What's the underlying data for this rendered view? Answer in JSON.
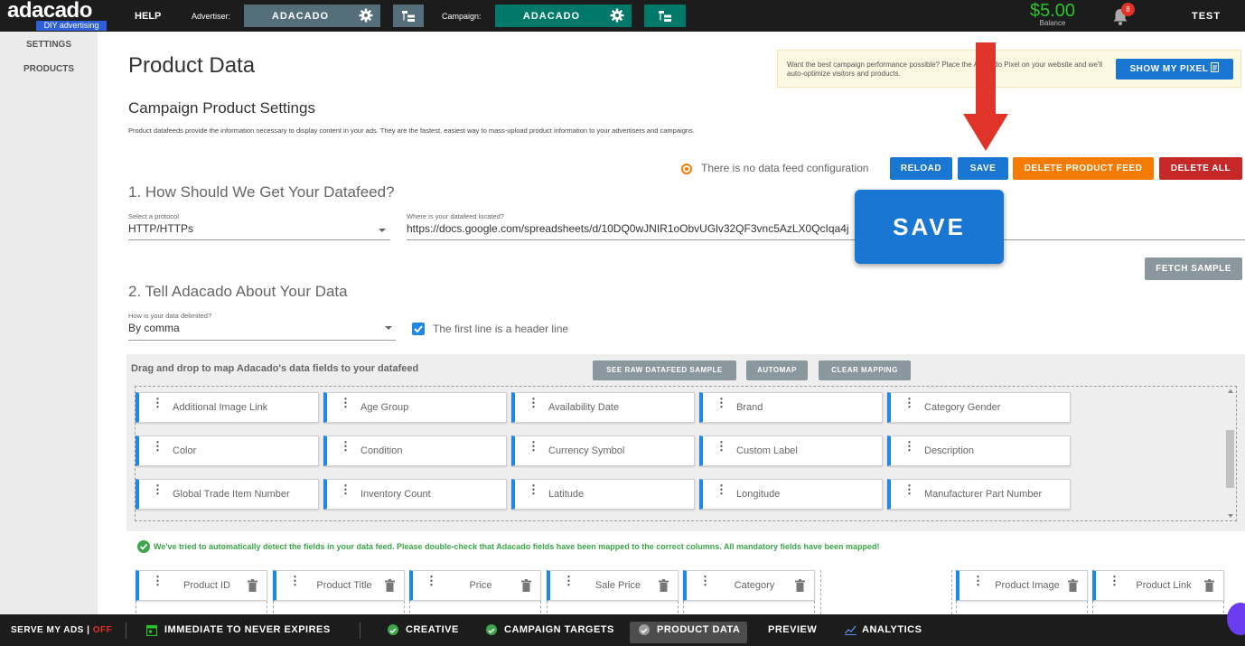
{
  "topbar": {
    "logo_text_main": "adacado",
    "logo_tagline": "DIY advertising",
    "help_label": "HELP",
    "advertiser_label": "Advertiser:",
    "advertiser_value": "ADACADO",
    "campaign_label": "Campaign:",
    "campaign_value": "ADACADO",
    "balance_amount": "$5.00",
    "balance_label": "Balance",
    "notification_count": "8",
    "user_label": "TEST",
    "colors": {
      "bar": "#1c1c1c",
      "advertiser": "#546e7a",
      "campaign": "#00796b",
      "balance": "#27c42c"
    }
  },
  "sidebar": {
    "items": [
      {
        "label": "SETTINGS"
      },
      {
        "label": "PRODUCTS"
      }
    ]
  },
  "main": {
    "page_title": "Product Data",
    "pixel_banner": {
      "text": "Want the best campaign performance possible? Place the Adacado Pixel on your website and we'll auto-optimize visitors and products.",
      "button_label": "SHOW MY PIXEL"
    },
    "campaign_settings_title": "Campaign Product Settings",
    "description": "Product datafeeds provide the information necessary to display content in your ads. They are the fastest, easiest way to mass-upload product information to your advertisers and campaigns.",
    "status_text": "There is no data feed configuration",
    "actions": {
      "reload": "RELOAD",
      "save": "SAVE",
      "delete_feed": "DELETE PRODUCT FEED",
      "delete_all": "DELETE ALL"
    },
    "step1": {
      "title": "1. How Should We Get Your Datafeed?",
      "protocol_label": "Select a protocol",
      "protocol_value": "HTTP/HTTPs",
      "location_label": "Where is your datafeed located?",
      "location_value": "https://docs.google.com/spreadsheets/d/10DQ0wJNIR1oObvUGlv32QF3vnc5AzLX0QcIqa4j",
      "fetch_label": "FETCH SAMPLE"
    },
    "step2": {
      "title": "2. Tell Adacado About Your Data",
      "delimiter_label": "How is your data delimited?",
      "delimiter_value": "By comma",
      "header_checkbox_label": "The first line is a header line",
      "header_checked": true
    },
    "mapping": {
      "title": "Drag and drop to map Adacado's data fields to your datafeed",
      "raw_sample_label": "SEE RAW DATAFEED SAMPLE",
      "automap_label": "AUTOMAP",
      "clear_label": "CLEAR MAPPING",
      "fields": [
        "Additional Image Link",
        "Age Group",
        "Availability Date",
        "Brand",
        "Category Gender",
        "Color",
        "Condition",
        "Currency Symbol",
        "Custom Label",
        "Description",
        "Global Trade Item Number",
        "Inventory Count",
        "Latitude",
        "Longitude",
        "Manufacturer Part Number"
      ],
      "success_message": "We've tried to automatically detect the fields in your data feed. Please double-check that Adacado fields have been mapped to the correct columns. All mandatory fields have been mapped!",
      "mapped_columns": [
        "Product ID",
        "Product Title",
        "Price",
        "Sale Price",
        "Category",
        "",
        "Product Image",
        "Product Link"
      ]
    }
  },
  "callout": {
    "save_big_label": "SAVE",
    "arrow_color": "#e0332a"
  },
  "bottombar": {
    "serve_label": "SERVE MY ADS |",
    "serve_state": "OFF",
    "schedule_label": "IMMEDIATE TO NEVER EXPIRES",
    "tabs": [
      {
        "label": "CREATIVE",
        "status": "done"
      },
      {
        "label": "CAMPAIGN TARGETS",
        "status": "done"
      },
      {
        "label": "PRODUCT DATA",
        "status": "active"
      },
      {
        "label": "PREVIEW",
        "status": "none"
      },
      {
        "label": "ANALYTICS",
        "status": "none"
      }
    ]
  }
}
